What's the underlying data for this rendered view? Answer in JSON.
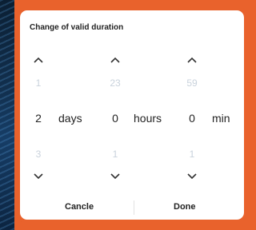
{
  "dialog": {
    "title": "Change of valid duration"
  },
  "picker": {
    "days": {
      "prev": "1",
      "value": "2",
      "next": "3",
      "unit": "days"
    },
    "hours": {
      "prev": "23",
      "value": "0",
      "next": "1",
      "unit": "hours"
    },
    "minutes": {
      "prev": "59",
      "value": "0",
      "next": "1",
      "unit": "min"
    }
  },
  "footer": {
    "cancel_label": "Cancle",
    "done_label": "Done"
  },
  "colors": {
    "accent_border": "#e9622c",
    "faded_number": "#c9d2dc"
  },
  "icons": {
    "up": "chevron-up-icon",
    "down": "chevron-down-icon"
  }
}
